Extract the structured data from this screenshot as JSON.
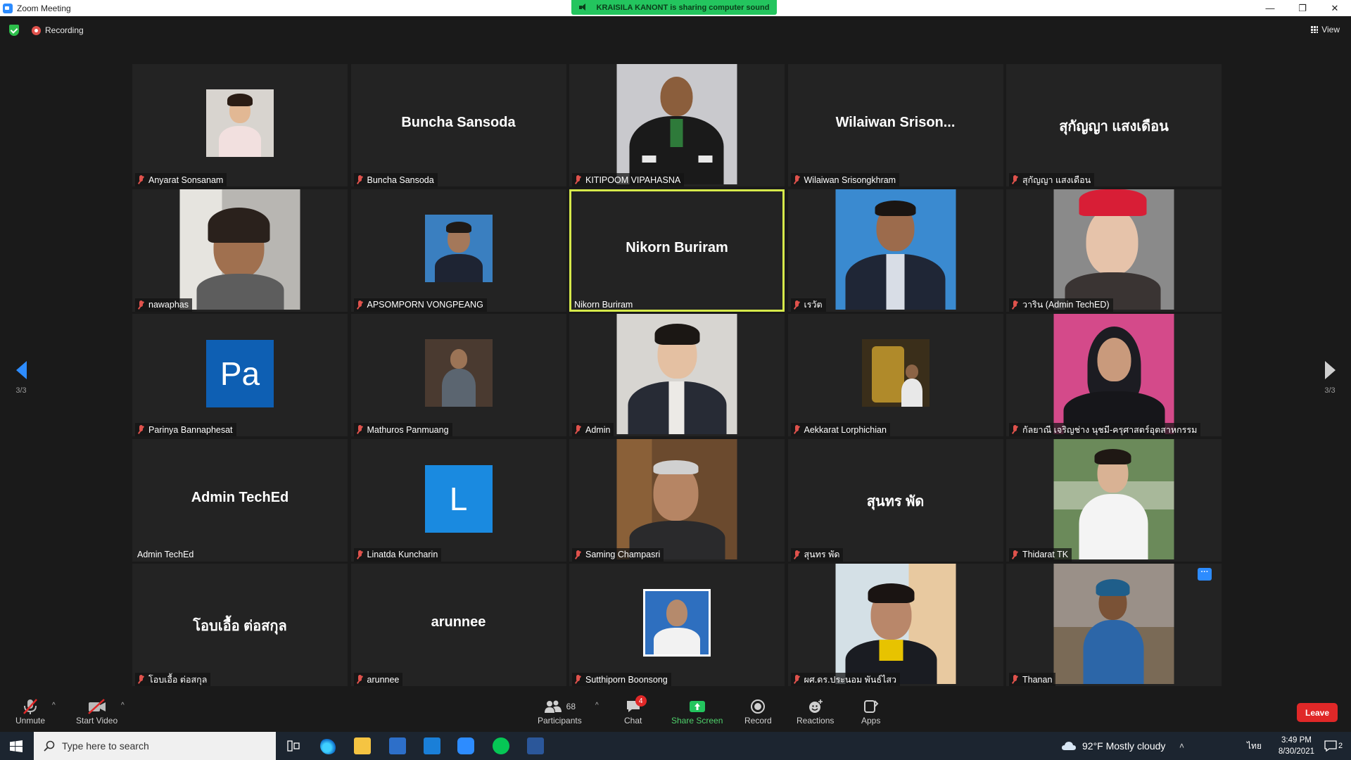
{
  "window": {
    "title": "Zoom Meeting",
    "minimize": "—",
    "maximize": "❐",
    "close": "✕"
  },
  "share_banner": "KRAISILA KANONT is sharing computer sound",
  "topbar": {
    "recording": "Recording",
    "view": "View"
  },
  "pagination": {
    "left": "3/3",
    "right": "3/3"
  },
  "tiles": [
    {
      "label": "Anyarat Sonsanam",
      "big": ""
    },
    {
      "label": "Buncha Sansoda",
      "big": "Buncha Sansoda"
    },
    {
      "label": "KITIPOOM VIPAHASNA",
      "big": ""
    },
    {
      "label": "Wilaiwan Srisongkhram",
      "big": "Wilaiwan  Srison..."
    },
    {
      "label": "สุกัญญา  แสงเดือน",
      "big": "สุกัญญา  แสงเดือน"
    },
    {
      "label": "nawaphas",
      "big": ""
    },
    {
      "label": "APSOMPORN VONGPEANG",
      "big": ""
    },
    {
      "label": "Nikorn Buriram",
      "big": "Nikorn Buriram"
    },
    {
      "label": "เรวัต",
      "big": ""
    },
    {
      "label": "วาริน  (Admin TechED)",
      "big": ""
    },
    {
      "label": "Parinya Bannaphesat",
      "big": "Pa"
    },
    {
      "label": "Mathuros Panmuang",
      "big": ""
    },
    {
      "label": "Admin",
      "big": ""
    },
    {
      "label": "Aekkarat Lorphichian",
      "big": ""
    },
    {
      "label": "กัลยาณี เจริญช่าง นุชมี-ครุศาสตร์อุตสาหกรรม",
      "big": ""
    },
    {
      "label": "Admin TechEd",
      "big": "Admin TechEd"
    },
    {
      "label": "Linatda Kuncharin",
      "big": "L"
    },
    {
      "label": "Saming Champasri",
      "big": ""
    },
    {
      "label": "สุนทร พัด",
      "big": "สุนทร พัด"
    },
    {
      "label": "Thidarat TK",
      "big": ""
    },
    {
      "label": "โอบเอื้อ ต่อสกุล",
      "big": "โอบเอื้อ ต่อสกุล"
    },
    {
      "label": "arunnee",
      "big": "arunnee"
    },
    {
      "label": "Sutthiporn Boonsong",
      "big": ""
    },
    {
      "label": "ผศ.ดร.ประนอม พันธ์ไสว",
      "big": ""
    },
    {
      "label": "Thanan",
      "big": ""
    }
  ],
  "tile_menu": "···",
  "toolbar": {
    "unmute": "Unmute",
    "start_video": "Start Video",
    "participants": "Participants",
    "participants_count": "68",
    "chat": "Chat",
    "chat_badge": "4",
    "share_screen": "Share Screen",
    "record": "Record",
    "reactions": "Reactions",
    "apps": "Apps",
    "leave": "Leave",
    "caret": "^"
  },
  "taskbar": {
    "search_placeholder": "Type here to search",
    "weather": "92°F  Mostly cloudy",
    "language": "ไทย",
    "time": "3:49 PM",
    "date": "8/30/2021",
    "notifications": "2"
  },
  "colors": {
    "active_border": "#d6e94a",
    "share_green": "#23c55e",
    "leave_red": "#e02828",
    "zoom_blue": "#2d8cff"
  }
}
